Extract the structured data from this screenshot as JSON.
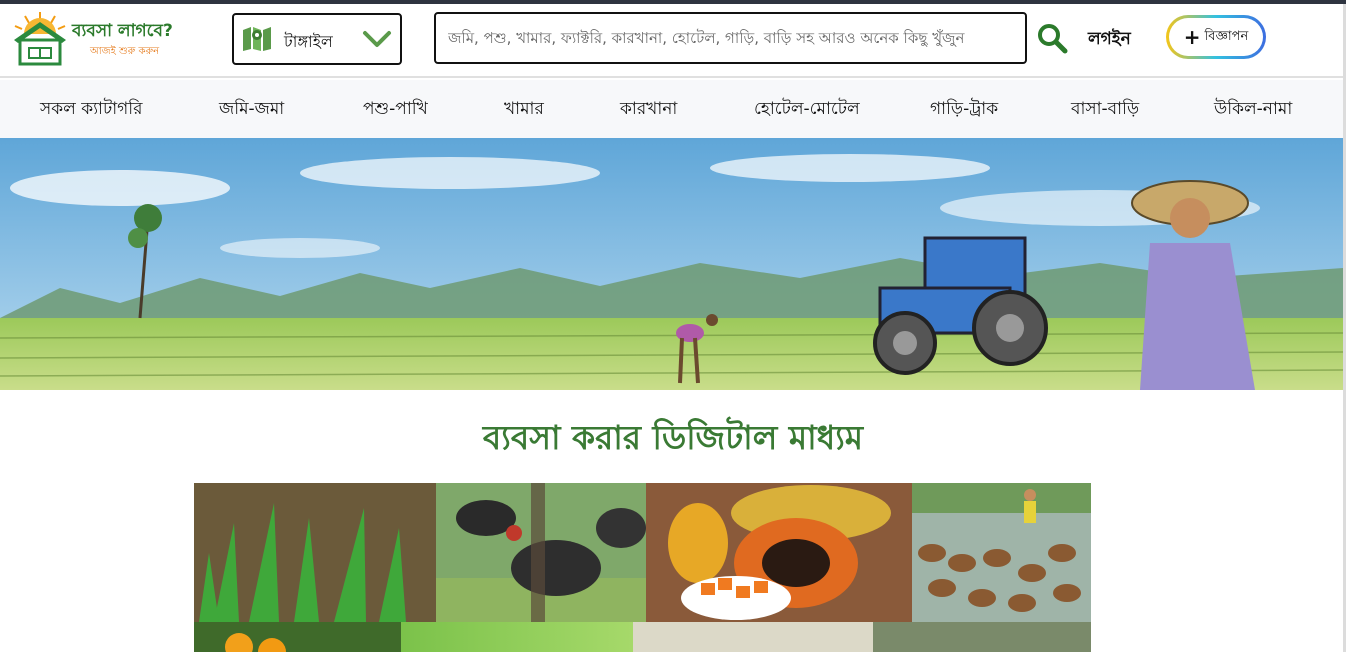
{
  "header": {
    "logo_title": "ব্যবসা লাগবে?",
    "logo_tagline": "আজই শুরু করুন",
    "location": "টাঙ্গাইল",
    "search_placeholder": "জমি, পশু, খামার, ফ্যাক্টরি, কারখানা, হোটেল, গাড়ি, বাড়ি সহ আরও অনেক কিছু খুঁজুন",
    "login_label": "লগইন",
    "ad_label": "বিজ্ঞাপন",
    "ad_plus": "+"
  },
  "nav": {
    "items": [
      "সকল ক্যাটাগরি",
      "জমি-জমা",
      "পশু-পাখি",
      "খামার",
      "কারখানা",
      "হোটেল-মোটেল",
      "গাড়ি-ট্রাক",
      "বাসা-বাড়ি",
      "উকিল-নামা"
    ]
  },
  "main": {
    "headline": "ব্যবসা করার ডিজিটাল মাধ্যম"
  },
  "icons": {
    "location": "map-icon",
    "dropdown": "chevron-down-icon",
    "search": "search-icon"
  },
  "colors": {
    "brand_green": "#3a7a34",
    "accent_orange": "#e67e22"
  }
}
